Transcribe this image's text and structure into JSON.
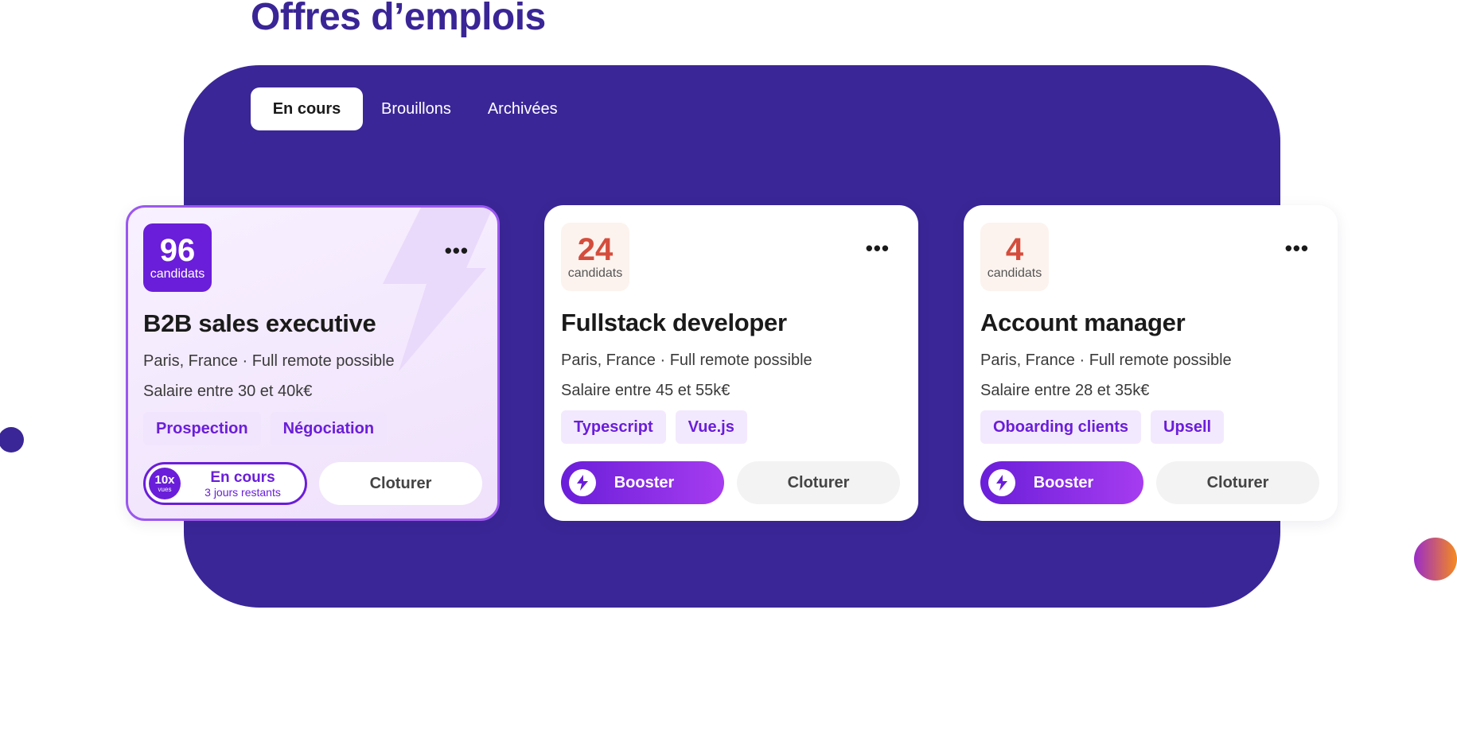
{
  "page_title": "Offres d’emplois",
  "tabs": [
    {
      "label": "En cours",
      "active": true
    },
    {
      "label": "Brouillons",
      "active": false
    },
    {
      "label": "Archivées",
      "active": false
    }
  ],
  "colors": {
    "brand_purple": "#3b2697",
    "accent_violet": "#6a1ed9",
    "badge_number_gradient": [
      "#d44d3c",
      "#9b2cc8"
    ]
  },
  "cards": [
    {
      "count": "96",
      "count_label": "candidats",
      "title": "B2B sales executive",
      "location": "Paris, France · Full remote possible",
      "salary": "Salaire entre 30 et 40k€",
      "tags": [
        "Prospection",
        "Négociation"
      ],
      "status": {
        "views": "10x",
        "views_label": "vues",
        "title": "En cours",
        "subtitle": "3 jours restants"
      },
      "close_label": "Cloturer",
      "more_icon": "more-horizontal-icon"
    },
    {
      "count": "24",
      "count_label": "candidats",
      "title": "Fullstack developer",
      "location": "Paris, France · Full remote possible",
      "salary": "Salaire entre 45 et 55k€",
      "tags": [
        "Typescript",
        "Vue.js"
      ],
      "booster_label": "Booster",
      "close_label": "Cloturer",
      "more_icon": "more-horizontal-icon"
    },
    {
      "count": "4",
      "count_label": "candidats",
      "title": "Account manager",
      "location": "Paris, France · Full remote possible",
      "salary": "Salaire entre 28 et 35k€",
      "tags": [
        "Oboarding clients",
        "Upsell"
      ],
      "booster_label": "Booster",
      "close_label": "Cloturer",
      "more_icon": "more-horizontal-icon"
    }
  ]
}
